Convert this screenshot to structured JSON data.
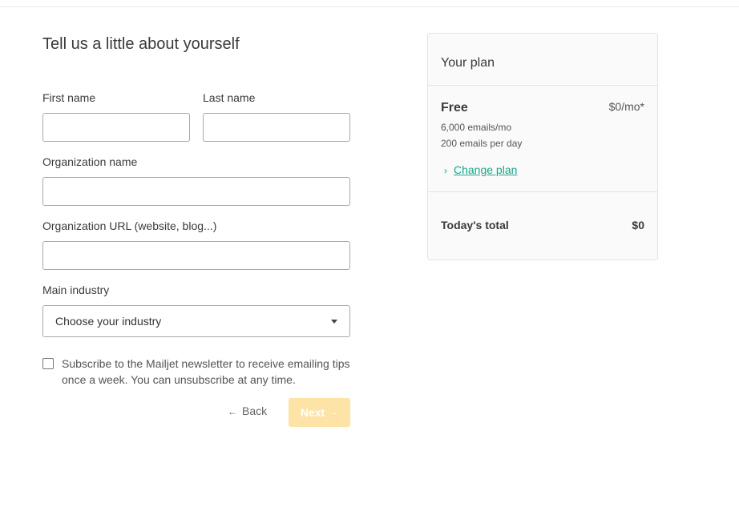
{
  "form": {
    "title": "Tell us a little about yourself",
    "first_name": {
      "label": "First name",
      "value": ""
    },
    "last_name": {
      "label": "Last name",
      "value": ""
    },
    "org_name": {
      "label": "Organization name",
      "value": ""
    },
    "org_url": {
      "label": "Organization URL (website, blog...)",
      "value": ""
    },
    "industry": {
      "label": "Main industry",
      "selected": "Choose your industry"
    },
    "newsletter": {
      "checked": false,
      "label": "Subscribe to the Mailjet newsletter to receive emailing tips once a week. You can unsubscribe at any time."
    },
    "back_label": "Back",
    "next_label": "Next"
  },
  "plan": {
    "title": "Your plan",
    "name": "Free",
    "price": "$0/mo*",
    "details": [
      "6,000 emails/mo",
      "200 emails per day"
    ],
    "change_label": "Change plan",
    "total_label": "Today's total",
    "total_value": "$0"
  },
  "colors": {
    "accent_link": "#1aa58b",
    "next_button_disabled": "#fde4a6"
  },
  "icons": {
    "back": "left-arrow-icon",
    "next": "right-arrow-icon",
    "change_plan": "chevron-right-icon",
    "select": "caret-down-icon"
  }
}
